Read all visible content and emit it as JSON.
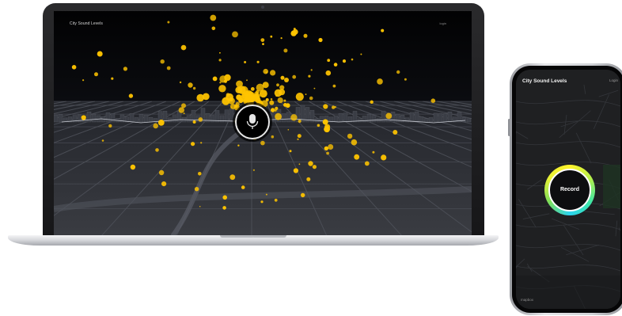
{
  "laptop": {
    "app_title": "City Sound Levels",
    "login_label": "login",
    "mic_icon": "microphone-icon"
  },
  "phone": {
    "app_title": "City Sound Levels",
    "login_label": "Login",
    "record_label": "Record",
    "attribution": "mapbox"
  },
  "colors": {
    "dot_yellow": "#ffc400",
    "screen_bg": "#050507",
    "ring_green": "#3ee7a6",
    "ring_yellow": "#fff32a"
  }
}
